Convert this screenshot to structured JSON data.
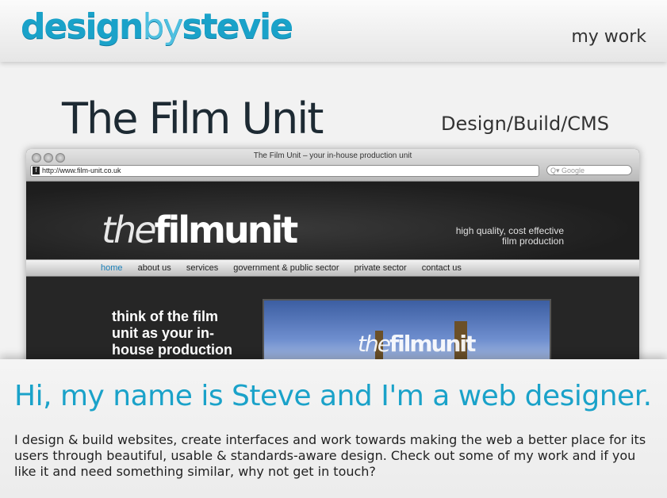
{
  "header": {
    "logo_bold": "design",
    "logo_light": "by",
    "logo_bold2": "stevie",
    "nav_label": "my work"
  },
  "project": {
    "title": "The Film Unit",
    "type": "Design/Build/CMS"
  },
  "browser": {
    "window_title": "The Film Unit – your in-house production unit",
    "url": "http://www.film-unit.co.uk",
    "search_placeholder": "Google",
    "site": {
      "logo_thin": "the",
      "logo_bold": "filmunit",
      "tagline_line1": "high quality, cost effective",
      "tagline_line2": "film production",
      "nav": [
        "home",
        "about us",
        "services",
        "government & public sector",
        "private sector",
        "contact us"
      ],
      "slogan": "think of the film unit as your in-house production unit",
      "photo_logo_thin": "the",
      "photo_logo_bold": "filmunit"
    }
  },
  "intro": {
    "title": "Hi, my name is Steve and I'm a web designer.",
    "text": "I design & build websites, create interfaces and work towards making the web a better place for its users through beautiful, usable & standards-aware design. Check out some of my work and if you like it and need something similar, why not get in touch?"
  },
  "colors": {
    "brand": "#1aa2c9",
    "nav_active": "#1a7fb8"
  }
}
